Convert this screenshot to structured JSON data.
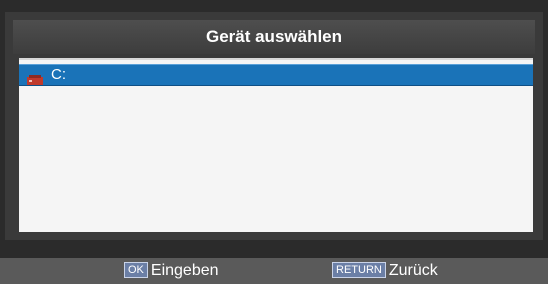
{
  "dialog": {
    "title": "Gerät auswählen"
  },
  "devices": [
    {
      "label": "C:",
      "icon": "drive-icon",
      "selected": true
    }
  ],
  "footer": {
    "ok_key": "OK",
    "ok_label": "Eingeben",
    "return_key": "RETURN",
    "return_label": "Zurück"
  },
  "colors": {
    "selection": "#1a73b8",
    "background": "#2b2b2b",
    "list_bg": "#f5f5f5",
    "footer_bg": "#5a5a5a",
    "key_bg": "#6b7fa6",
    "drive_icon": "#c0392b"
  }
}
